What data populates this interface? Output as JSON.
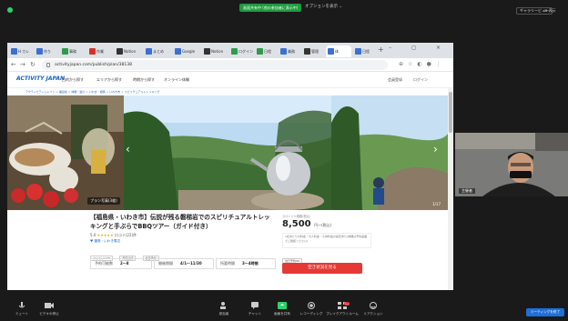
{
  "zoom": {
    "top_banner": "画面共有中 (他の参加者に表示中)",
    "top_label": "オプションを表示 ⌄",
    "view_button": "ギャラリービュー",
    "view_label": "⊞ 表示",
    "end_button": "ミーティングを終了",
    "toolbar": [
      {
        "label": "ミュート"
      },
      {
        "label": "ビデオの停止"
      },
      {
        "label": "参加者"
      },
      {
        "label": "チャット"
      },
      {
        "label": "画面を共有"
      },
      {
        "label": "レコーディング"
      },
      {
        "label": "ブレイクアウトルーム"
      },
      {
        "label": "リアクション"
      }
    ],
    "toolbar_badge": "1+",
    "participant_name": "主催者"
  },
  "browser": {
    "tabs": [
      {
        "label": "H カレ"
      },
      {
        "label": "作り"
      },
      {
        "label": "事務"
      },
      {
        "label": "作業"
      },
      {
        "label": "Notion"
      },
      {
        "label": "まとめ"
      },
      {
        "label": "Google"
      },
      {
        "label": "Notion"
      },
      {
        "label": "ログイン"
      },
      {
        "label": "日程"
      },
      {
        "label": "業務"
      },
      {
        "label": "管理"
      },
      {
        "label": "体"
      },
      {
        "label": "日程"
      }
    ],
    "url": "activityjapan.com/publish/plan/38138",
    "window_controls": "– ◻ ×"
  },
  "site": {
    "logo": "ACTIVITY JAPAN",
    "nav": [
      "目的から探す",
      "エリアから探す",
      "時期から探す",
      "オンライン体験"
    ],
    "header_right": [
      "会員登録",
      "ログイン"
    ],
    "breadcrumb": "アクティビティジャパン > 福島県 > 体験・遊び > いわき・相馬 > いわき市 > スピリチュアルトレッキング",
    "photo_caption": "プラン写真(3枚)",
    "photo_counter": "1/17",
    "title": "【福島県・いわき市】伝説が残る磐梯岩でのスピリチュアルトレッキングと手ぶらでBBQツアー（ガイド付き）",
    "rating_stars": "★★★★★",
    "rating_score": "5.0",
    "rating_text": "口コミ(22)件",
    "location": "♥ 福島・いわき周辺",
    "tags": [
      "ファミリーOK",
      "雨天決行",
      "当日予約"
    ],
    "info": [
      {
        "label": "予約可能数",
        "value": "2〜8"
      },
      {
        "label": "開催期間",
        "value": "4/1〜11/30"
      },
      {
        "label": "所要時間",
        "value": "3〜4時間"
      }
    ],
    "price_small": "スペシャル価格(税込)",
    "price_value": "8,500",
    "price_unit": "円〜(税込)",
    "booking_note": "1名あたりの料金・大人料金・子供料金の設定あり(詳細は予約画面でご確認ください)",
    "booking_tag": "当日予約OK",
    "reserve_button": "空き状況を見る"
  }
}
